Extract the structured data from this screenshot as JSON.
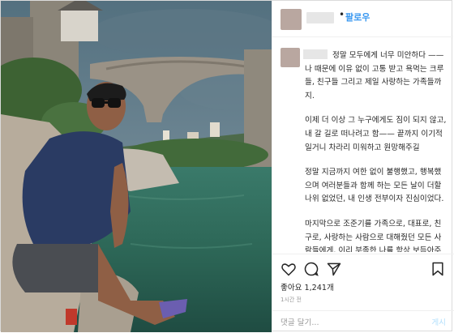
{
  "header": {
    "follow_label": "팔로우",
    "dot": "•"
  },
  "caption": {
    "paragraphs": [
      "정말 모두에게 너무 미안하다 —— 나 때문에 이유 없이 고통 받고 욕먹는 크루들, 친구들 그리고 제일 사랑하는 가족들까지.",
      "이제 더 이상 그 누구에게도 짐이 되지 않고, 내 갈 길로 떠나려고 함—— 끝까지 이기적일거니 차라리 미워하고 원망해주길",
      "정말 지금까지 여한 없이 불행했고, 행복했으며 여러분들과 함께 하는 모든 날이 더할나위 없었던, 내 인생 전부이자 진심이었다.",
      "마지막으로 조준기를 가족으로, 대표로, 친구로, 사랑하는 사람으로 대해줬던 모든 사람들에게, 이리 부족한 나를 항상 보듬아주고 응원해줘서 고마웠다고 이렇게 얼굴도 못 보고 정말 정고"
    ]
  },
  "icons": {
    "like": "heart-icon",
    "comment": "comment-icon",
    "share": "share-icon",
    "save": "bookmark-icon"
  },
  "stats": {
    "likes": "좋아요 1,241개",
    "time": "1시간 전"
  },
  "comment_box": {
    "placeholder": "댓글 달기...",
    "post_label": "게시"
  },
  "colors": {
    "accent": "#3897f0",
    "post_disabled": "#b2dffc",
    "border": "#dbdbdb"
  }
}
